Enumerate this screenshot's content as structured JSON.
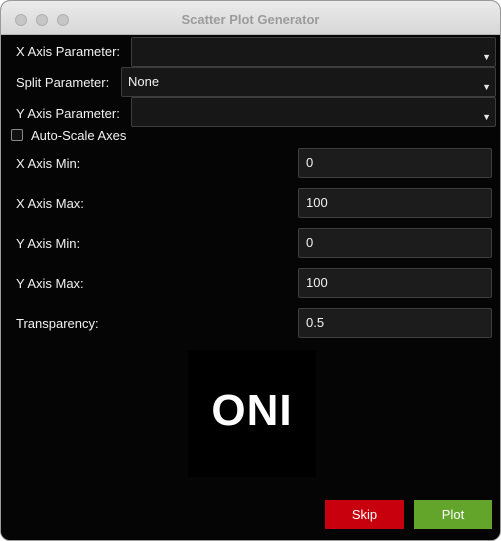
{
  "window": {
    "title": "Scatter Plot Generator"
  },
  "x_axis_param": {
    "label": "X Axis Parameter:",
    "value": ""
  },
  "split_param": {
    "label": "Split Parameter:",
    "value": "None"
  },
  "y_axis_param": {
    "label": "Y Axis Parameter:",
    "value": ""
  },
  "auto_scale": {
    "label": "Auto-Scale Axes",
    "checked": false
  },
  "x_min": {
    "label": "X Axis Min:",
    "value": "0"
  },
  "x_max": {
    "label": "X Axis Max:",
    "value": "100"
  },
  "y_min": {
    "label": "Y Axis Min:",
    "value": "0"
  },
  "y_max": {
    "label": "Y Axis Max:",
    "value": "100"
  },
  "transparency": {
    "label": "Transparency:",
    "value": "0.5"
  },
  "logo": {
    "text": "ONI"
  },
  "buttons": {
    "skip": "Skip",
    "plot": "Plot"
  },
  "colors": {
    "skip_button": "#c8000d",
    "plot_button": "#62a52a",
    "background": "#050505"
  },
  "icons": {
    "dropdown": "chevron-down-icon",
    "window_controls": [
      "close-icon",
      "minimize-icon",
      "zoom-icon"
    ]
  }
}
